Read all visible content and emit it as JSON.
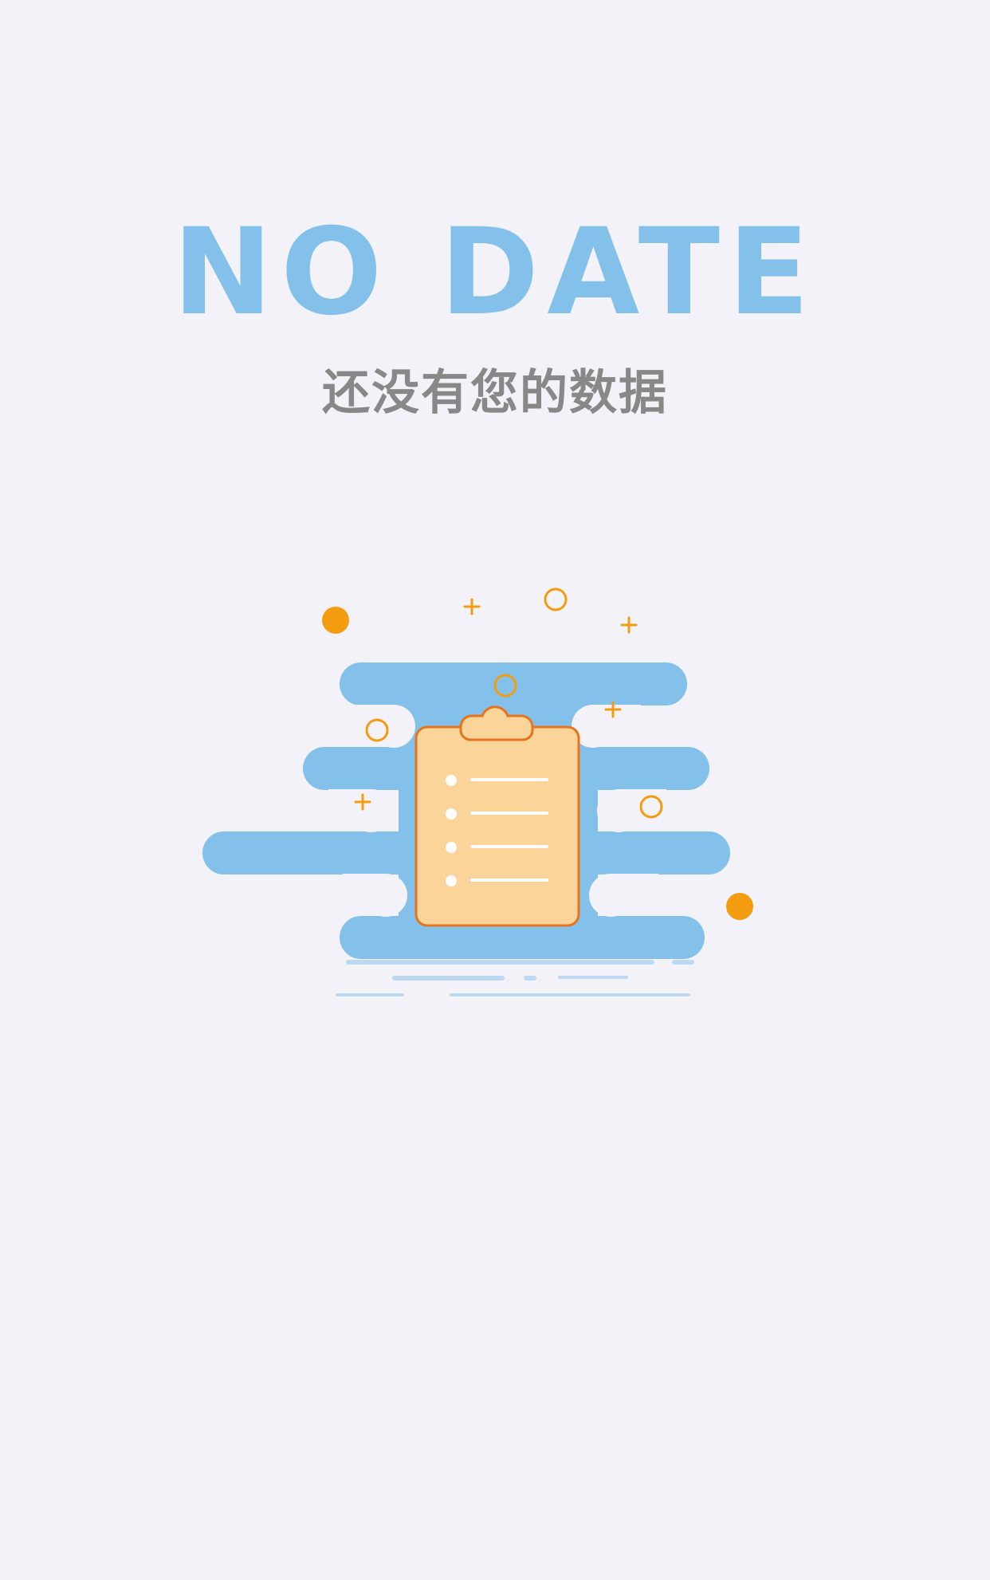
{
  "empty_state": {
    "title": "NO DATE",
    "subtitle": "还没有您的数据",
    "illustration": {
      "icon": "clipboard-icon",
      "list_item_count": 4
    }
  },
  "colors": {
    "background": "#f3f2f8",
    "title": "#83c1ea",
    "subtitle": "#888888",
    "cloud": "#83c1ea",
    "cloud_lines": "#bcd9f1",
    "clipboard_fill": "#fbd49a",
    "clipboard_stroke": "#e8731f",
    "accent": "#f39c0f"
  }
}
